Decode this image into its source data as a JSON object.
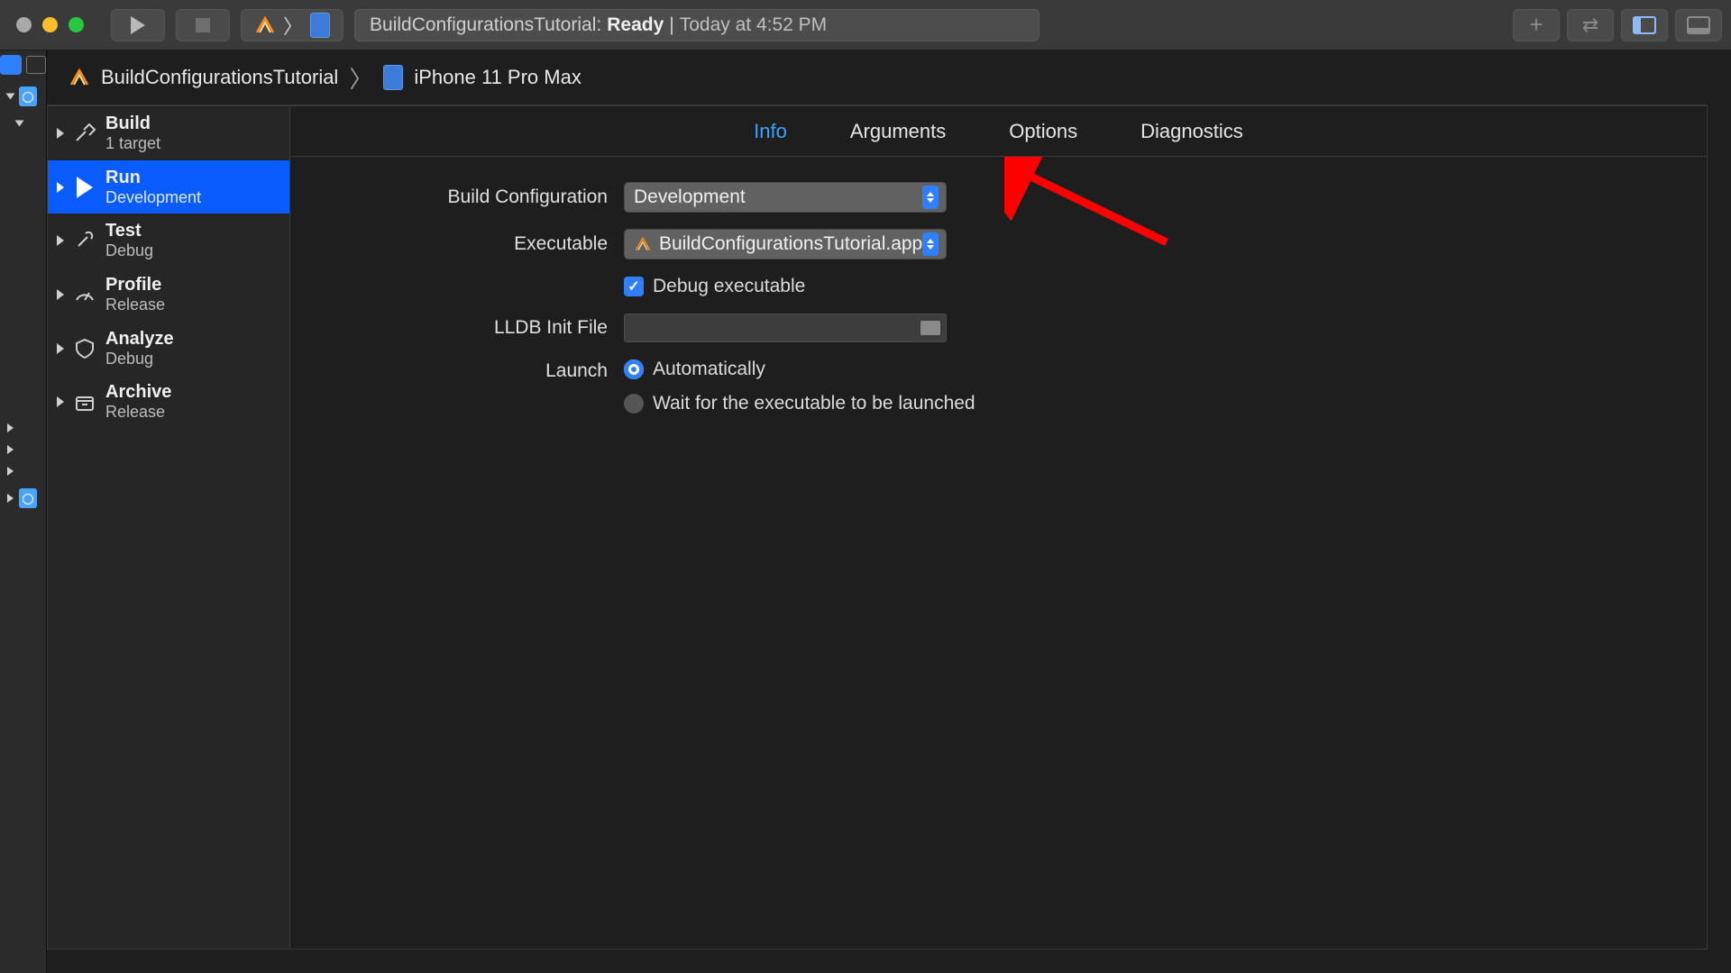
{
  "toolbar": {
    "status_project": "BuildConfigurationsTutorial:",
    "status_ready": "Ready",
    "status_sep": "|",
    "status_time": "Today at 4:52 PM"
  },
  "breadcrumb": {
    "project": "BuildConfigurationsTutorial",
    "device": "iPhone 11 Pro Max"
  },
  "scheme": {
    "items": [
      {
        "title": "Build",
        "subtitle": "1 target",
        "icon": "hammer"
      },
      {
        "title": "Run",
        "subtitle": "Development",
        "icon": "play"
      },
      {
        "title": "Test",
        "subtitle": "Debug",
        "icon": "wrench"
      },
      {
        "title": "Profile",
        "subtitle": "Release",
        "icon": "gauge"
      },
      {
        "title": "Analyze",
        "subtitle": "Debug",
        "icon": "shield"
      },
      {
        "title": "Archive",
        "subtitle": "Release",
        "icon": "box"
      }
    ]
  },
  "detail": {
    "tabs": {
      "info": "Info",
      "arguments": "Arguments",
      "options": "Options",
      "diagnostics": "Diagnostics"
    },
    "labels": {
      "build_configuration": "Build Configuration",
      "executable": "Executable",
      "debug_executable": "Debug executable",
      "lldb_init": "LLDB Init File",
      "launch": "Launch"
    },
    "values": {
      "build_configuration": "Development",
      "executable": "BuildConfigurationsTutorial.app",
      "launch_auto": "Automatically",
      "launch_wait": "Wait for the executable to be launched"
    }
  }
}
